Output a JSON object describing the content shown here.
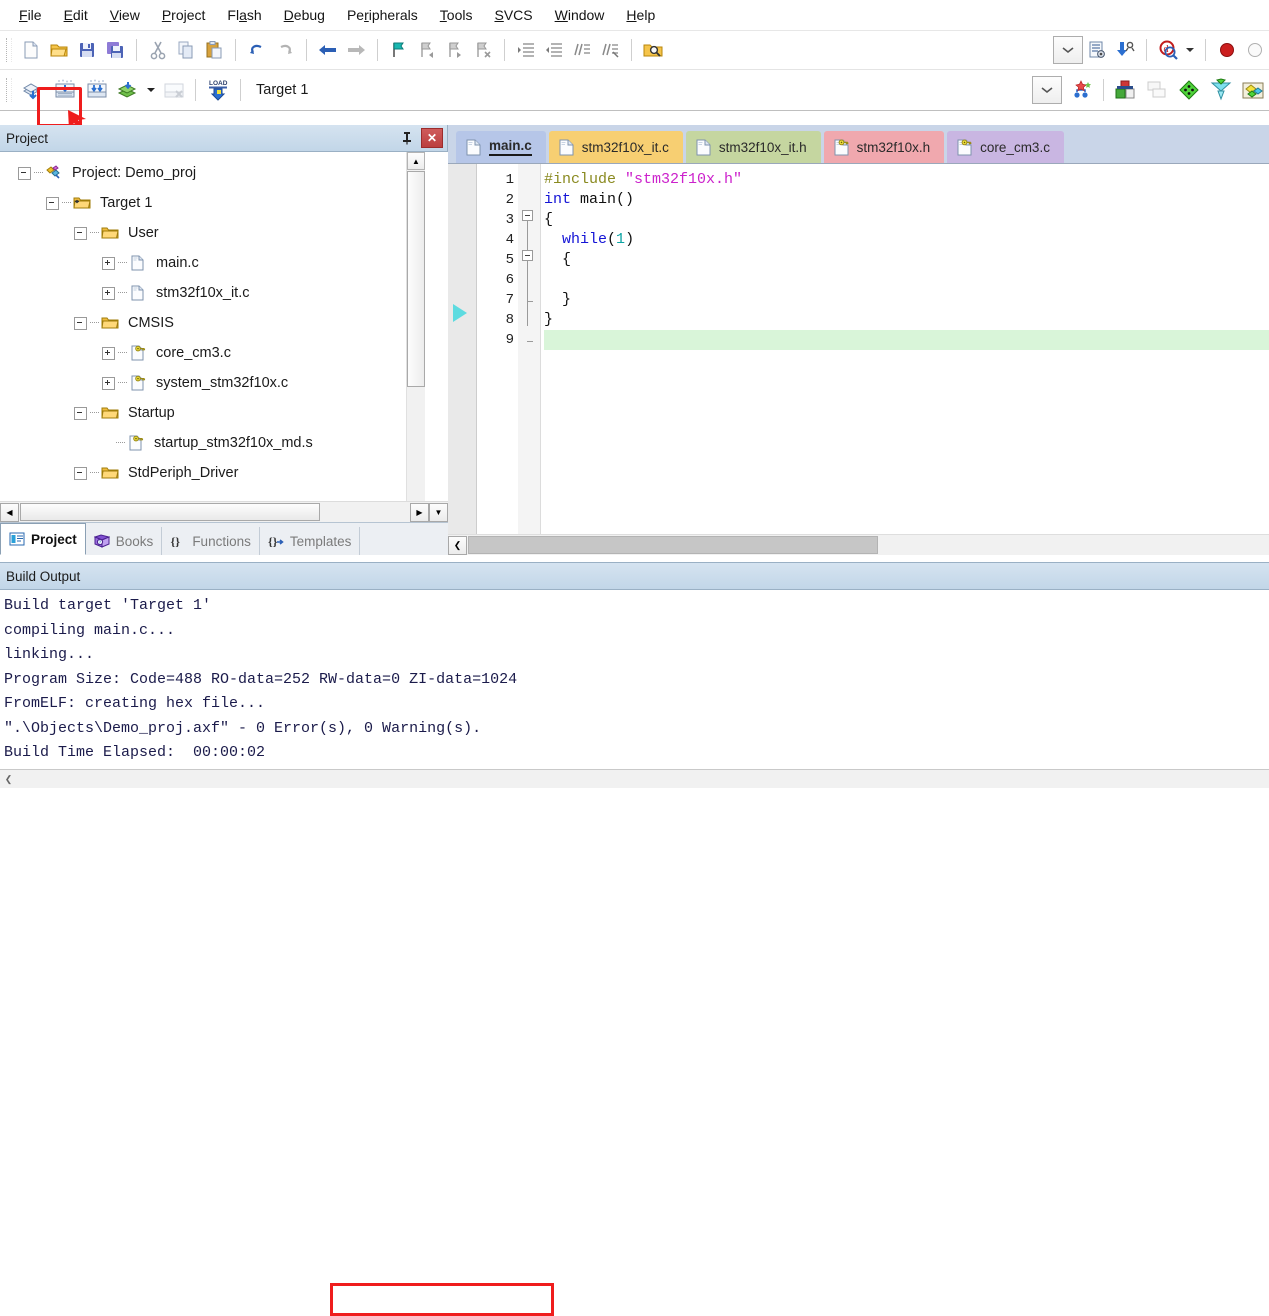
{
  "menu": {
    "items": [
      {
        "label": "File",
        "accel": "F"
      },
      {
        "label": "Edit",
        "accel": "E"
      },
      {
        "label": "View",
        "accel": "V"
      },
      {
        "label": "Project",
        "accel": "P"
      },
      {
        "label": "Flash",
        "accel": "a"
      },
      {
        "label": "Debug",
        "accel": "D"
      },
      {
        "label": "Peripherals",
        "accel": "r"
      },
      {
        "label": "Tools",
        "accel": "T"
      },
      {
        "label": "SVCS",
        "accel": "S"
      },
      {
        "label": "Window",
        "accel": "W"
      },
      {
        "label": "Help",
        "accel": "H"
      }
    ]
  },
  "toolbar_main": {
    "buttons": [
      {
        "name": "new-file-icon",
        "title": "New"
      },
      {
        "name": "open-file-icon",
        "title": "Open"
      },
      {
        "name": "save-icon",
        "title": "Save"
      },
      {
        "name": "save-all-icon",
        "title": "Save All"
      },
      {
        "name": "cut-icon",
        "title": "Cut"
      },
      {
        "name": "copy-icon",
        "title": "Copy"
      },
      {
        "name": "paste-icon",
        "title": "Paste"
      },
      {
        "name": "undo-icon",
        "title": "Undo"
      },
      {
        "name": "redo-icon",
        "title": "Redo"
      },
      {
        "name": "navigate-back-icon",
        "title": "Back"
      },
      {
        "name": "navigate-forward-icon",
        "title": "Forward"
      },
      {
        "name": "bookmark-toggle-icon",
        "title": "Insert/Remove Bookmark"
      },
      {
        "name": "bookmark-prev-icon",
        "title": "Previous Bookmark"
      },
      {
        "name": "bookmark-next-icon",
        "title": "Next Bookmark"
      },
      {
        "name": "bookmark-clear-icon",
        "title": "Clear All Bookmarks"
      },
      {
        "name": "indent-right-icon",
        "title": "Indent"
      },
      {
        "name": "indent-left-icon",
        "title": "Outdent"
      },
      {
        "name": "comment-icon",
        "title": "Comment"
      },
      {
        "name": "uncomment-icon",
        "title": "Uncomment"
      },
      {
        "name": "find-in-files-icon",
        "title": "Find in Files"
      }
    ],
    "right_buttons": [
      {
        "name": "combo-dropdown-icon",
        "title": "Dropdown"
      },
      {
        "name": "configure-icon",
        "title": "Configuration Wizard"
      },
      {
        "name": "download-icon",
        "title": "Download"
      },
      {
        "name": "debug-session-icon",
        "title": "Start/Stop Debug Session"
      },
      {
        "name": "debug-dropdown-icon",
        "title": "Debug Options"
      },
      {
        "name": "record-icon",
        "title": "Record"
      },
      {
        "name": "stop-icon",
        "title": "Stop"
      }
    ]
  },
  "toolbar_build": {
    "buttons": [
      {
        "name": "translate-file-icon",
        "title": "Translate Current File"
      },
      {
        "name": "build-target-icon",
        "title": "Build",
        "highlighted": true
      },
      {
        "name": "rebuild-all-icon",
        "title": "Rebuild all target files"
      },
      {
        "name": "batch-build-icon",
        "title": "Batch Build"
      },
      {
        "name": "batch-build-dropdown-icon",
        "title": "Batch Build Options"
      },
      {
        "name": "stop-build-icon",
        "title": "Stop Build"
      },
      {
        "name": "load-icon",
        "title": "Download to Flash",
        "glyph": "LOAD"
      }
    ],
    "target_value": "Target 1",
    "right_buttons": [
      {
        "name": "target-dropdown-icon",
        "title": "Select Target"
      },
      {
        "name": "target-options-icon",
        "title": "Options for Target"
      },
      {
        "name": "manage-runtime-icon",
        "title": "Manage Run-Time Environment"
      },
      {
        "name": "manage-multi-project-icon",
        "title": "Manage Multi-Project Workspace"
      },
      {
        "name": "components-icon",
        "title": "Components, Environment, Books"
      },
      {
        "name": "pack-installer-icon",
        "title": "Pack Installer"
      },
      {
        "name": "pack-manager-icon",
        "title": "Manage Packs"
      }
    ]
  },
  "project_panel": {
    "title": "Project",
    "pin_icon": "pin-icon",
    "close_icon": "close-icon",
    "tree": [
      {
        "label": "Project: Demo_proj",
        "depth": 0,
        "toggle": "minus",
        "icon": "project-icon"
      },
      {
        "label": "Target 1",
        "depth": 1,
        "toggle": "minus",
        "icon": "target-folder-icon"
      },
      {
        "label": "User",
        "depth": 2,
        "toggle": "minus",
        "icon": "folder-icon"
      },
      {
        "label": "main.c",
        "depth": 3,
        "toggle": "plus",
        "icon": "c-file-icon"
      },
      {
        "label": "stm32f10x_it.c",
        "depth": 3,
        "toggle": "plus",
        "icon": "c-file-icon"
      },
      {
        "label": "CMSIS",
        "depth": 2,
        "toggle": "minus",
        "icon": "folder-icon"
      },
      {
        "label": "core_cm3.c",
        "depth": 3,
        "toggle": "plus",
        "icon": "key-file-icon"
      },
      {
        "label": "system_stm32f10x.c",
        "depth": 3,
        "toggle": "plus",
        "icon": "key-file-icon"
      },
      {
        "label": "Startup",
        "depth": 2,
        "toggle": "minus",
        "icon": "folder-icon"
      },
      {
        "label": "startup_stm32f10x_md.s",
        "depth": 3,
        "toggle": "none",
        "icon": "key-file-icon"
      },
      {
        "label": "StdPeriph_Driver",
        "depth": 2,
        "toggle": "minus",
        "icon": "folder-icon"
      }
    ],
    "tabs": [
      {
        "label": "Project",
        "icon": "project-tab-icon",
        "active": true
      },
      {
        "label": "Books",
        "icon": "books-icon",
        "active": false
      },
      {
        "label": "Functions",
        "icon": "functions-icon",
        "active": false
      },
      {
        "label": "Templates",
        "icon": "templates-icon",
        "active": false
      }
    ]
  },
  "editor": {
    "tabs": [
      {
        "label": "main.c",
        "icon": "c-file-icon",
        "color": "#b6c6e8",
        "active": true
      },
      {
        "label": "stm32f10x_it.c",
        "icon": "c-file-icon",
        "color": "#f7cf72",
        "active": false
      },
      {
        "label": "stm32f10x_it.h",
        "icon": "h-file-icon",
        "color": "#c5d6a0",
        "active": false
      },
      {
        "label": "stm32f10x.h",
        "icon": "key-file-icon",
        "color": "#f0a8ae",
        "active": false
      },
      {
        "label": "core_cm3.c",
        "icon": "key-file-icon",
        "color": "#c9b6e2",
        "active": false
      }
    ],
    "line_numbers": [
      "1",
      "2",
      "3",
      "4",
      "5",
      "6",
      "7",
      "8",
      "9"
    ],
    "code_lines": [
      {
        "n": 1,
        "tokens": [
          {
            "t": "#include ",
            "c": "pre"
          },
          {
            "t": "\"stm32f10x.h\"",
            "c": "str"
          }
        ],
        "highlight": false
      },
      {
        "n": 2,
        "tokens": [
          {
            "t": "int",
            "c": "kw"
          },
          {
            "t": " main()",
            "c": "txt"
          }
        ],
        "highlight": false
      },
      {
        "n": 3,
        "tokens": [
          {
            "t": "{",
            "c": "txt"
          }
        ],
        "highlight": false
      },
      {
        "n": 4,
        "tokens": [
          {
            "t": "  ",
            "c": "txt"
          },
          {
            "t": "while",
            "c": "kw"
          },
          {
            "t": "(",
            "c": "txt"
          },
          {
            "t": "1",
            "c": "num"
          },
          {
            "t": ")",
            "c": "txt"
          }
        ],
        "highlight": false
      },
      {
        "n": 5,
        "tokens": [
          {
            "t": "  {",
            "c": "txt"
          }
        ],
        "highlight": false
      },
      {
        "n": 6,
        "tokens": [
          {
            "t": "",
            "c": "txt"
          }
        ],
        "highlight": false
      },
      {
        "n": 7,
        "tokens": [
          {
            "t": "  }",
            "c": "txt"
          }
        ],
        "highlight": false
      },
      {
        "n": 8,
        "tokens": [
          {
            "t": "}",
            "c": "txt"
          }
        ],
        "highlight": false
      },
      {
        "n": 9,
        "tokens": [
          {
            "t": "",
            "c": "txt"
          }
        ],
        "highlight": true
      }
    ],
    "breakpoint_marker": "execution-arrow-icon"
  },
  "build_output": {
    "title": "Build Output",
    "lines": [
      "Build target 'Target 1'",
      "compiling main.c...",
      "linking...",
      "Program Size: Code=488 RO-data=252 RW-data=0 ZI-data=1024",
      "FromELF: creating hex file...",
      "\".\\Objects\\Demo_proj.axf\" - 0 Error(s), 0 Warning(s).",
      "Build Time Elapsed:  00:00:02"
    ],
    "highlight_text": "0 Error(s), 0 Warning(s)."
  },
  "annotations": {
    "build_button_box_color": "#ef1d1d",
    "error_line_box_color": "#ef1d1d",
    "arrow_color": "#ef1d1d"
  }
}
